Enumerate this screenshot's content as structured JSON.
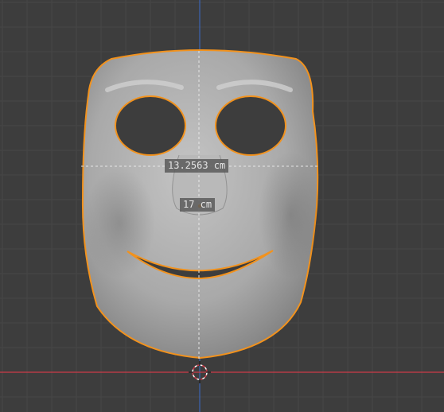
{
  "viewport": {
    "background": "#3d3d3d",
    "grid_line_color": "#474747",
    "x_axis_color": "#cc3b48",
    "z_axis_color": "#3b6bcc",
    "selection_outline_color": "#f2921d",
    "mesh_color": "#b3b3b3"
  },
  "object": {
    "name_icon": "mask-mesh-icon",
    "selected": true
  },
  "measurements": {
    "width_label": "13.2563 cm",
    "height_label": "17 cm"
  },
  "cursor": {
    "icon": "3d-cursor-icon"
  }
}
